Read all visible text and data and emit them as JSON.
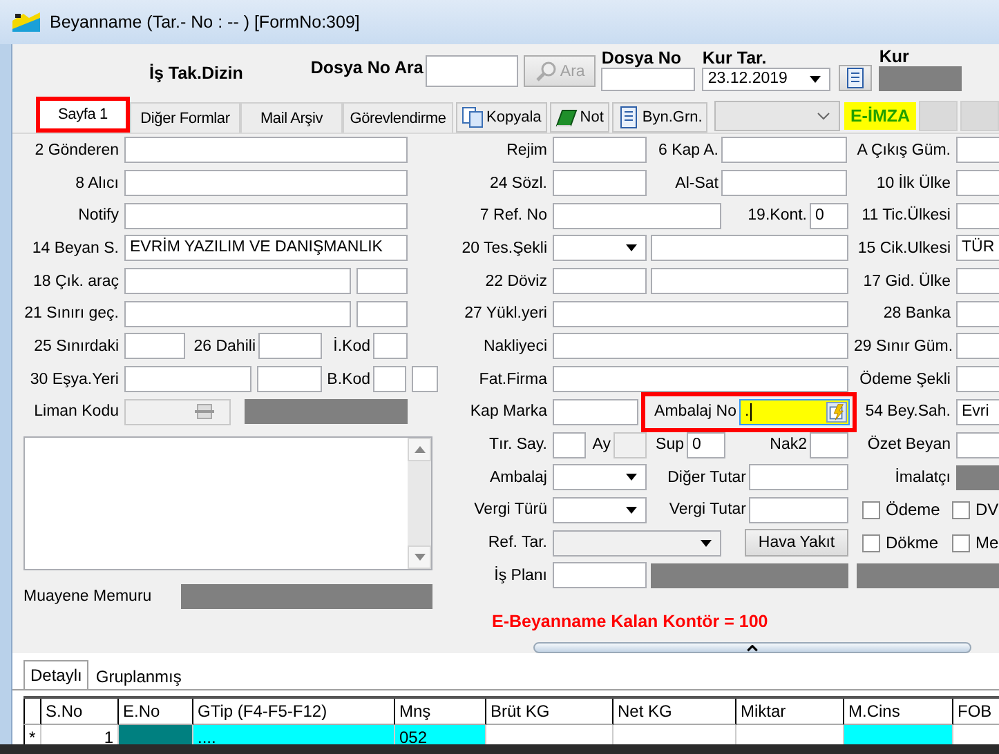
{
  "window": {
    "title": "Beyanname (Tar.- No :  --  )  [FormNo:309]"
  },
  "header": {
    "dizin_label": "İş Tak.Dizin",
    "search_label": "Dosya No Ara",
    "search_button": {
      "label": "Ara",
      "disabled": true
    },
    "dosya_no_label": "Dosya No",
    "kur_tar_label": "Kur Tar.",
    "kur_tar_value": "23.12.2019",
    "kur_label": "Kur"
  },
  "tabs": [
    {
      "label": "Sayfa 1",
      "selected": true,
      "highlighted": true
    },
    {
      "label": "Diğer Formlar",
      "selected": false,
      "highlighted": false
    },
    {
      "label": "Mail Arşiv",
      "selected": false,
      "highlighted": false
    },
    {
      "label": "Görevlendirme",
      "selected": false,
      "highlighted": false
    }
  ],
  "toolbar": {
    "buttons": [
      "Kopyala",
      "Not",
      "Byn.Grn."
    ],
    "badge": "E-İMZA"
  },
  "left_rows": [
    [
      {
        "kind": "label",
        "text": "2 Gönderen"
      },
      {
        "kind": "field"
      }
    ],
    [
      {
        "kind": "label",
        "text": "8 Alıcı"
      },
      {
        "kind": "field"
      }
    ],
    [
      {
        "kind": "label",
        "text": "Notify"
      },
      {
        "kind": "field"
      }
    ],
    [
      {
        "kind": "label",
        "text": "14 Beyan S."
      },
      {
        "kind": "field",
        "value": "EVRİM YAZILIM VE DANIŞMANLIK"
      }
    ],
    [
      {
        "kind": "label",
        "text": "18 Çık. araç"
      },
      {
        "kind": "field"
      },
      {
        "kind": "field"
      }
    ],
    [
      {
        "kind": "label",
        "text": "21 Sınırı geç."
      },
      {
        "kind": "field"
      },
      {
        "kind": "field"
      }
    ],
    [
      {
        "kind": "label",
        "text": "25 Sınırdaki"
      },
      {
        "kind": "field"
      },
      {
        "kind": "label",
        "text": "26 Dahili"
      },
      {
        "kind": "field"
      },
      {
        "kind": "label",
        "text": "İ.Kod"
      },
      {
        "kind": "field"
      }
    ],
    [
      {
        "kind": "label",
        "text": "30 Eşya.Yeri"
      },
      {
        "kind": "field"
      },
      {
        "kind": "field"
      },
      {
        "kind": "label",
        "text": "B.Kod"
      },
      {
        "kind": "field"
      },
      {
        "kind": "field"
      }
    ],
    [
      {
        "kind": "label",
        "text": "Liman Kodu"
      },
      {
        "kind": "lookup"
      },
      {
        "kind": "disabled"
      }
    ]
  ],
  "muayene_label": "Muayene Memuru",
  "middle_rows": [
    [
      {
        "kind": "label",
        "text": "Rejim"
      },
      {
        "kind": "field"
      },
      {
        "kind": "label",
        "text": "6 Kap A."
      },
      {
        "kind": "field"
      }
    ],
    [
      {
        "kind": "label",
        "text": "24 Sözl."
      },
      {
        "kind": "field"
      },
      {
        "kind": "label",
        "text": "Al-Sat"
      },
      {
        "kind": "field"
      }
    ],
    [
      {
        "kind": "label",
        "text": "7 Ref. No"
      },
      {
        "kind": "field"
      },
      {
        "kind": "label",
        "text": "19.Kont."
      },
      {
        "kind": "field",
        "value": "0"
      }
    ],
    [
      {
        "kind": "label",
        "text": "20 Tes.Şekli"
      },
      {
        "kind": "dropdown"
      },
      {
        "kind": "field"
      }
    ],
    [
      {
        "kind": "label",
        "text": "22 Döviz"
      },
      {
        "kind": "field"
      },
      {
        "kind": "field"
      }
    ],
    [
      {
        "kind": "label",
        "text": "27 Yükl.yeri"
      },
      {
        "kind": "field"
      }
    ],
    [
      {
        "kind": "label",
        "text": "Nakliyeci"
      },
      {
        "kind": "field"
      }
    ],
    [
      {
        "kind": "label",
        "text": "Fat.Firma"
      },
      {
        "kind": "field"
      }
    ],
    [
      {
        "kind": "label",
        "text": "Kap Marka"
      },
      {
        "kind": "field"
      },
      {
        "kind": "group",
        "highlighted": true,
        "items": [
          {
            "kind": "label",
            "text": "Ambalaj No"
          },
          {
            "kind": "picker",
            "value": ".",
            "focused": true
          }
        ]
      }
    ],
    [
      {
        "kind": "label",
        "text": "Tır. Say."
      },
      {
        "kind": "field"
      },
      {
        "kind": "label",
        "text": "Ay"
      },
      {
        "kind": "readonly"
      },
      {
        "kind": "label",
        "text": "Sup"
      },
      {
        "kind": "field",
        "value": "0"
      },
      {
        "kind": "label",
        "text": "Nak2"
      },
      {
        "kind": "field"
      }
    ],
    [
      {
        "kind": "label",
        "text": "Ambalaj"
      },
      {
        "kind": "dropdown"
      },
      {
        "kind": "label",
        "text": "Diğer Tutar"
      },
      {
        "kind": "field"
      }
    ],
    [
      {
        "kind": "label",
        "text": "Vergi Türü"
      },
      {
        "kind": "dropdown"
      },
      {
        "kind": "label",
        "text": "Vergi Tutar"
      },
      {
        "kind": "field"
      }
    ],
    [
      {
        "kind": "label",
        "text": "Ref. Tar."
      },
      {
        "kind": "dropdown",
        "disabled": true
      },
      {
        "kind": "button",
        "text": "Hava Yakıt"
      }
    ],
    [
      {
        "kind": "label",
        "text": "İş Planı"
      },
      {
        "kind": "field"
      },
      {
        "kind": "disabled"
      }
    ]
  ],
  "kontor_text": "E-Beyanname Kalan Kontör = 100",
  "right_rows": [
    [
      {
        "kind": "label",
        "text": "A Çıkış Güm."
      },
      {
        "kind": "field"
      }
    ],
    [
      {
        "kind": "label",
        "text": "10 İlk Ülke"
      },
      {
        "kind": "field"
      }
    ],
    [
      {
        "kind": "label",
        "text": "11 Tic.Ülkesi"
      },
      {
        "kind": "field"
      }
    ],
    [
      {
        "kind": "label",
        "text": "15 Cik.Ulkesi"
      },
      {
        "kind": "field",
        "value": "TÜR"
      }
    ],
    [
      {
        "kind": "label",
        "text": "17 Gid. Ülke"
      },
      {
        "kind": "field"
      }
    ],
    [
      {
        "kind": "label",
        "text": "28 Banka"
      },
      {
        "kind": "field"
      }
    ],
    [
      {
        "kind": "label",
        "text": "29 Sınır Güm."
      },
      {
        "kind": "field"
      }
    ],
    [
      {
        "kind": "label",
        "text": "Ödeme Şekli"
      },
      {
        "kind": "field"
      }
    ],
    [
      {
        "kind": "label",
        "text": "54 Bey.Sah."
      },
      {
        "kind": "field",
        "value": "Evri"
      }
    ],
    [
      {
        "kind": "label",
        "text": "Özet Beyan"
      },
      {
        "kind": "field"
      }
    ],
    [
      {
        "kind": "label",
        "text": "İmalatçı"
      },
      {
        "kind": "disabled"
      }
    ],
    [
      {
        "kind": "check",
        "text": "Ödeme",
        "checked": false
      },
      {
        "kind": "check",
        "text": "DV",
        "checked": false
      }
    ],
    [
      {
        "kind": "check",
        "text": "Dökme",
        "checked": false
      },
      {
        "kind": "check",
        "text": "Me",
        "checked": false
      }
    ],
    [
      {
        "kind": "disabled"
      }
    ]
  ],
  "detail_tabs": [
    {
      "label": "Detaylı",
      "selected": true
    },
    {
      "label": "Gruplanmış",
      "selected": false
    }
  ],
  "table": {
    "columns": [
      "",
      "S.No",
      "E.No",
      "GTip (F4-F5-F12)",
      "Mnş",
      "Brüt KG",
      "Net KG",
      "Miktar",
      "M.Cins",
      "FOB"
    ],
    "rows": [
      [
        {
          "text": "*"
        },
        {
          "text": "1"
        },
        {
          "color": "#008080"
        },
        {
          "text": "....",
          "color": "#00ffff"
        },
        {
          "text": "052",
          "color": "#00ffff"
        },
        {},
        {},
        {},
        {
          "color": "#00ffff"
        },
        {}
      ]
    ]
  }
}
